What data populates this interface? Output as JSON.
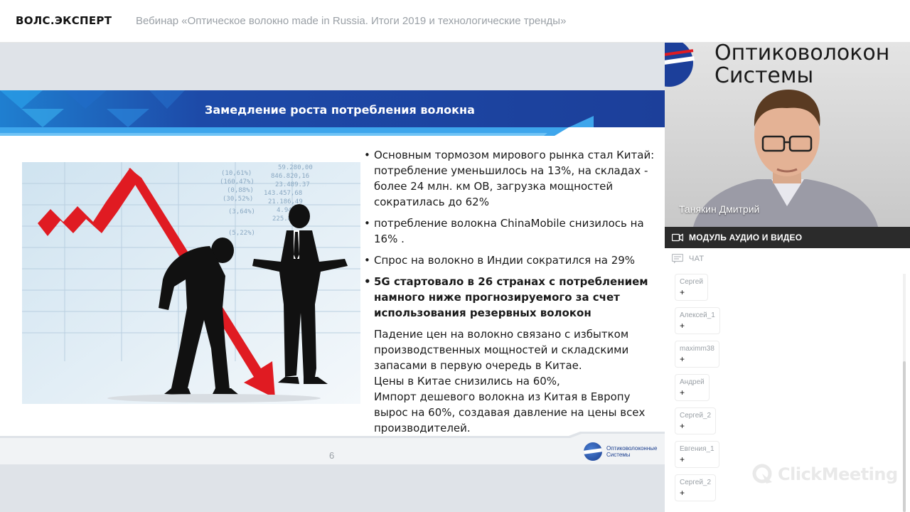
{
  "header": {
    "logo": "ВОЛС.ЭКСПЕРТ",
    "webinar_title": "Вебинар «Оптическое волокно made in Russia. Итоги 2019 и технологические тренды»"
  },
  "slide": {
    "title": "Замедление роста потребления волокна",
    "bullets": [
      {
        "text": "Основным тормозом мирового рынка стал Китай: потребление уменьшилось на 13%, на складах - более 24 млн. км ОВ, загрузка мощностей сократилась до 62%",
        "bold": false
      },
      {
        "text": "потребление волокна ChinaMobile снизилось на 16% .",
        "bold": false
      },
      {
        "text": "Спрос на волокно в Индии сократился на 29%",
        "bold": false
      },
      {
        "text": "5G стартовало  в 26 странах с потреблением намного ниже прогнозируемого за счет использования резервных волокон",
        "bold": true
      }
    ],
    "paragraph_lines": [
      "Падение цен на волокно связано с избытком производственных мощностей и складскими запасами в первую очередь в Китае.",
      "Цены в Китае снизились на  60%,",
      "Импорт дешевого волокна из Китая в Европу вырос на 60%, создавая давление на цены всех производителей."
    ],
    "page_number": "6",
    "footer_logo_line1": "Оптиковолоконные",
    "footer_logo_line2": "Системы",
    "image_table_values": [
      "59.280,00",
      "846.820,16",
      "23.489.37",
      "143.457,68",
      "21.186,49",
      "4.940,00",
      "225.88.67",
      "(10,61%)",
      "(160,47%)",
      "(0,88%)",
      "(30,52%)",
      "(3,64%)",
      "(5,22%)"
    ]
  },
  "video": {
    "background_sign_line1": "Оптиковолокон",
    "background_sign_line2": "Системы",
    "presenter_name": "Танякин Дмитрий",
    "module_label": "МОДУЛЬ АУДИО И ВИДЕО"
  },
  "chat": {
    "label": "ЧАТ",
    "messages": [
      {
        "author": "Сергей",
        "text": "+"
      },
      {
        "author": "Алексей_1",
        "text": "+"
      },
      {
        "author": "maximm38",
        "text": "+"
      },
      {
        "author": "Андрей",
        "text": "+"
      },
      {
        "author": "Сергей_2",
        "text": "+"
      },
      {
        "author": "Евгения_1",
        "text": "+"
      },
      {
        "author": "Сергей_2",
        "text": "+"
      }
    ]
  },
  "watermark": "ClickMeeting",
  "colors": {
    "slide_header_blue": "#1c3f9a",
    "arrow_red": "#e01b22",
    "av_bar": "#2b2b2b"
  }
}
